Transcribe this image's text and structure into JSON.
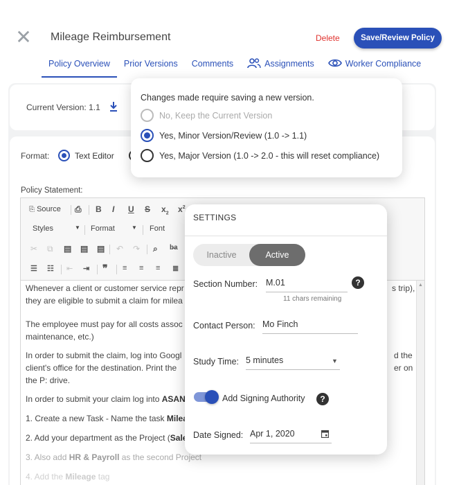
{
  "header": {
    "title": "Mileage Reimbursement",
    "delete_label": "Delete",
    "save_label": "Save/Review Policy"
  },
  "tabs": [
    {
      "label": "Policy Overview",
      "active": true
    },
    {
      "label": "Prior Versions"
    },
    {
      "label": "Comments"
    },
    {
      "label": "Assignments",
      "icon": "people-icon"
    },
    {
      "label": "Worker Compliance",
      "icon": "eye-icon"
    }
  ],
  "version": {
    "label": "Current Version:",
    "value": "1.1"
  },
  "format": {
    "label": "Format:",
    "selected": "Text Editor"
  },
  "policy": {
    "label": "Policy Statement:",
    "toolbar": {
      "source": "Source",
      "styles": "Styles",
      "format": "Format",
      "font": "Font"
    },
    "lines": [
      "Whenever a client or customer service repr",
      "they are eligible to submit a claim for milea",
      "The employee must pay for all costs assoc",
      "maintenance, etc.)",
      "In order to submit the claim, log into Googl",
      "client's office for the destination.  Print the",
      "the P: drive.",
      "In order to submit your claim log into ",
      "ASAN",
      "1. Create a new Task - Name the task ",
      "Milea",
      "2. Add your department as the Project (",
      "Sale",
      "3. Also add ",
      "HR & Payroll",
      " as the second Project",
      "4. Add the ",
      "Mileage",
      " tag"
    ],
    "right_fragments": [
      "s trip),",
      "d the",
      "er on"
    ]
  },
  "version_popup": {
    "title": "Changes made require saving a new version.",
    "options": [
      {
        "label": "No, Keep the Current Version",
        "disabled": true
      },
      {
        "label": "Yes, Minor Version/Review (1.0 -> 1.1)",
        "checked": true
      },
      {
        "label": "Yes, Major Version (1.0 -> 2.0 - this will reset compliance)"
      }
    ]
  },
  "settings": {
    "title": "SETTINGS",
    "status_inactive": "Inactive",
    "status_active": "Active",
    "section_number_label": "Section Number:",
    "section_number_value": "M.01",
    "section_number_hint": "11 chars remaining",
    "contact_label": "Contact Person:",
    "contact_value": "Mo Finch",
    "study_time_label": "Study Time:",
    "study_time_value": "5 minutes",
    "signing_label": "Add Signing Authority",
    "signing_enabled": true,
    "date_signed_label": "Date Signed:",
    "date_signed_value": "Apr 1, 2020"
  },
  "colors": {
    "accent": "#2a50b8",
    "danger": "#e0322e"
  }
}
